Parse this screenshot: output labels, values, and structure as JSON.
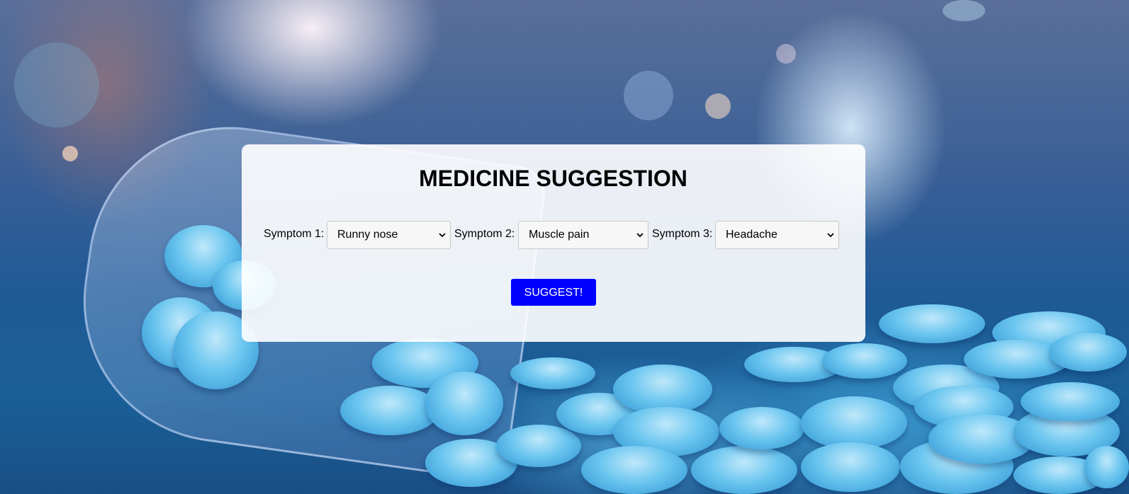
{
  "page": {
    "title": "MEDICINE SUGGESTION"
  },
  "form": {
    "symptoms": [
      {
        "label": "Symptom 1:",
        "selected": "Runny nose"
      },
      {
        "label": "Symptom 2:",
        "selected": "Muscle pain"
      },
      {
        "label": "Symptom 3:",
        "selected": "Headache"
      }
    ],
    "submit_label": "SUGGEST!"
  },
  "icons": {
    "dropdown": "chevron-down-icon"
  },
  "colors": {
    "button_bg": "#0000ff",
    "button_text": "#ffffff",
    "card_bg": "#ffffff"
  }
}
